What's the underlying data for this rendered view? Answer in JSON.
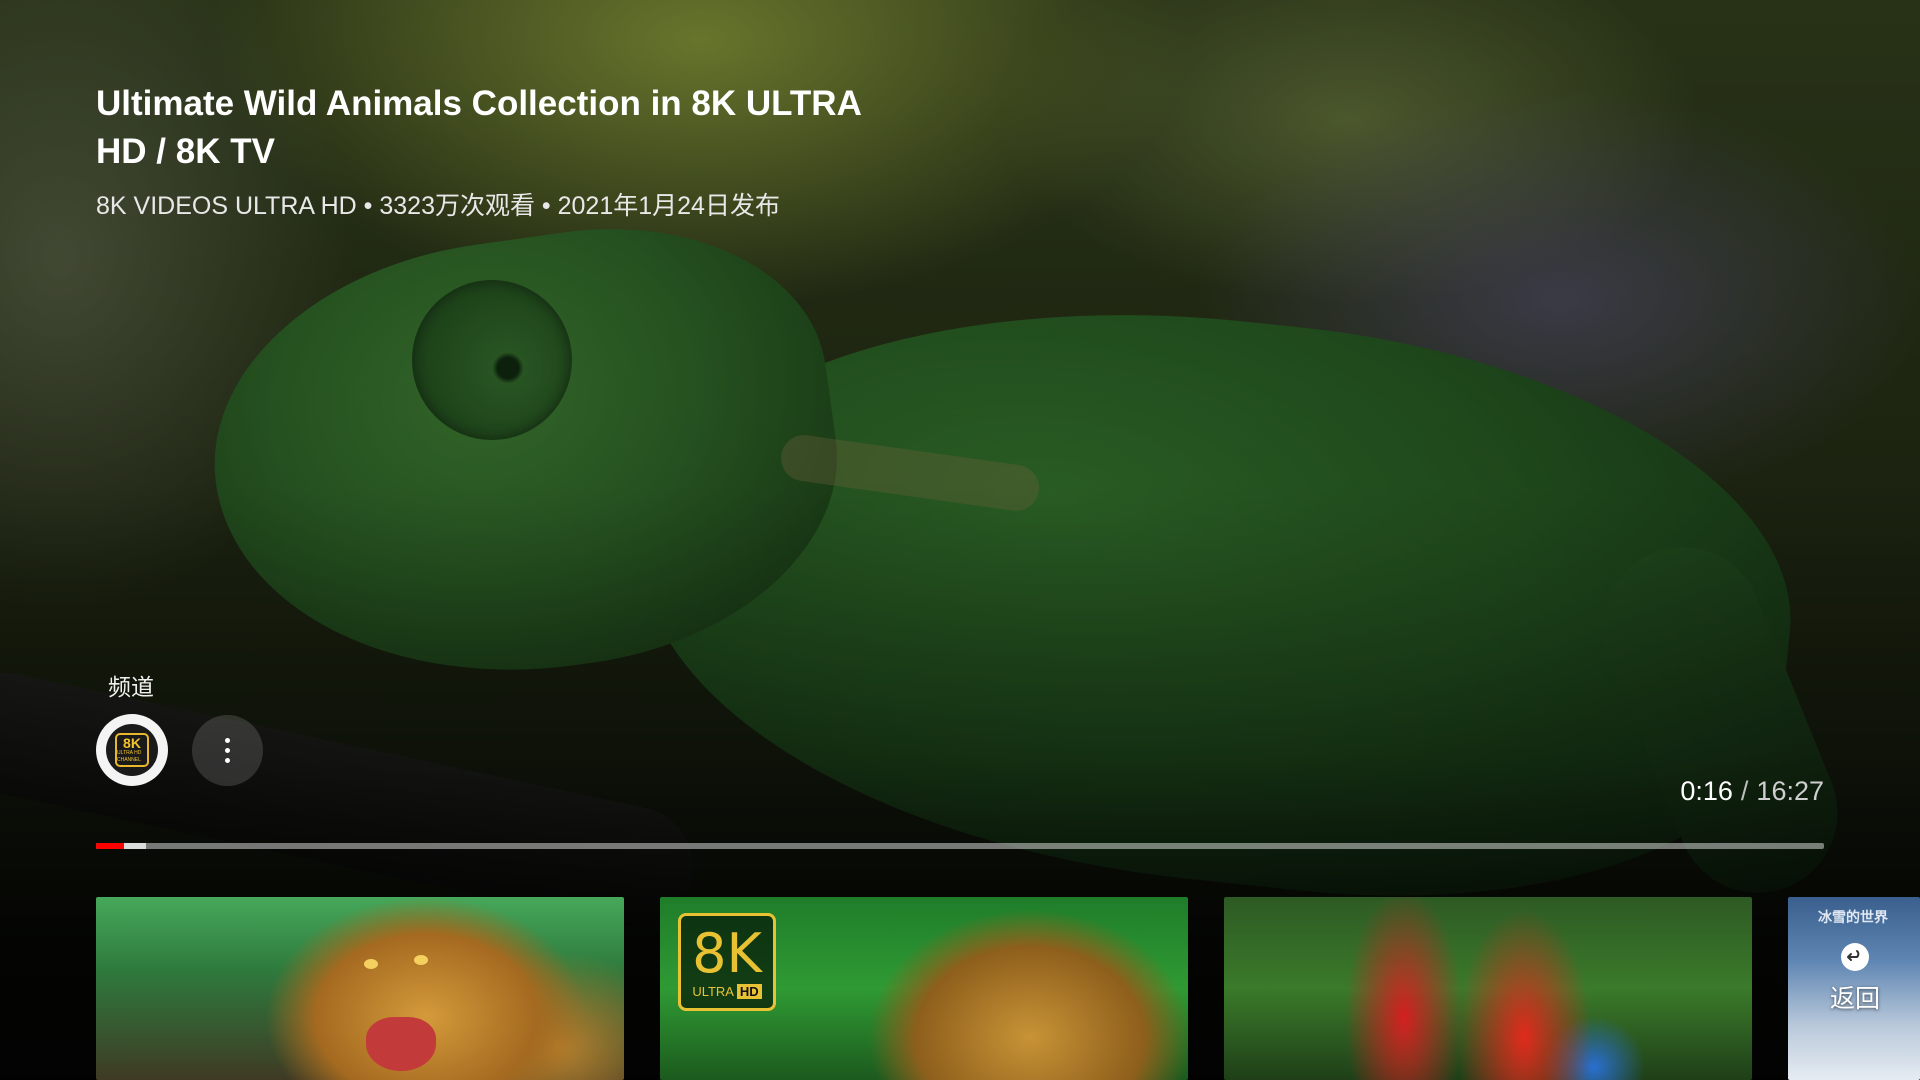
{
  "video": {
    "title": "Ultimate Wild Animals Collection in 8K ULTRA HD / 8K TV",
    "meta": "8K VIDEOS ULTRA HD • 3323万次观看 • 2021年1月24日发布"
  },
  "channel": {
    "label": "频道",
    "avatar_main": "8K",
    "avatar_sub": "ULTRA HD CHANNEL"
  },
  "playback": {
    "current": "0:16",
    "separator": "/",
    "total": "16:27",
    "played_fraction": 0.016,
    "buffered_fraction": 0.029
  },
  "thumbnails": {
    "badge_main": "8K",
    "badge_ultra": "ULTRA",
    "badge_hd": "HD",
    "fourth_caption": "冰雪的世界",
    "back_label": "返回"
  },
  "colors": {
    "progress_played": "#ff0000",
    "badge_gold": "#e9c233"
  },
  "icons": [
    "more-vert-icon",
    "back-arrow-icon"
  ]
}
